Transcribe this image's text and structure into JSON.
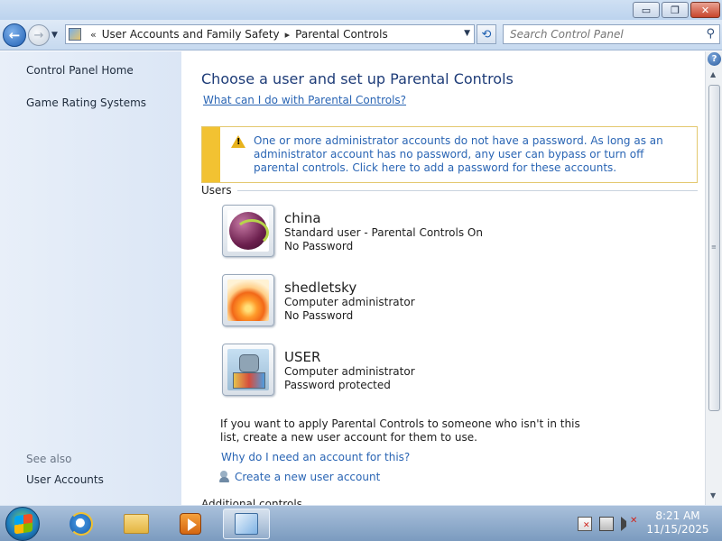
{
  "window": {
    "minimize_glyph": "▭",
    "maximize_glyph": "❐",
    "close_glyph": "✕"
  },
  "nav": {
    "breadcrumb_prefix": "«",
    "crumbs": [
      "User Accounts and Family Safety",
      "Parental Controls"
    ],
    "crumb_separator": "▸",
    "search_placeholder": "Search Control Panel",
    "icons": [
      "back-icon",
      "forward-icon",
      "history-dropdown-icon",
      "control-panel-icon",
      "address-dropdown-icon",
      "refresh-icon",
      "search-icon"
    ]
  },
  "sidebar": {
    "items": [
      {
        "label": "Control Panel Home"
      },
      {
        "label": "Game Rating Systems"
      }
    ],
    "see_also_label": "See also",
    "see_also_items": [
      {
        "label": "User Accounts"
      }
    ]
  },
  "main": {
    "heading": "Choose a user and set up Parental Controls",
    "help_link": "What can I do with Parental Controls?",
    "warning": "One or more administrator accounts do not have a password. As long as an administrator account has no password, any user can bypass or turn off parental controls. Click here to add a password for these accounts.",
    "users_label": "Users",
    "users": [
      {
        "name": "china",
        "line1": "Standard user - Parental Controls On",
        "line2": "No Password",
        "picture": "ball"
      },
      {
        "name": "shedletsky",
        "line1": "Computer administrator",
        "line2": "No Password",
        "picture": "flower"
      },
      {
        "name": "USER",
        "line1": "Computer administrator",
        "line2": "Password protected",
        "picture": "robot"
      }
    ],
    "info_text": "If you want to apply Parental Controls to someone who isn't in this list, create a new user account for them to use.",
    "why_link": "Why do I need an account for this?",
    "create_link": "Create a new user account",
    "additional_controls": "Additional controls"
  },
  "taskbar": {
    "apps": [
      "internet-explorer",
      "windows-explorer",
      "media-player",
      "control-panel"
    ],
    "active_app": "control-panel",
    "clock_time": "8:21 AM",
    "clock_date": "11/15/2025"
  },
  "colors": {
    "link": "#2a65b4",
    "heading": "#1e3c78",
    "warning_stripe": "#f2c232"
  }
}
